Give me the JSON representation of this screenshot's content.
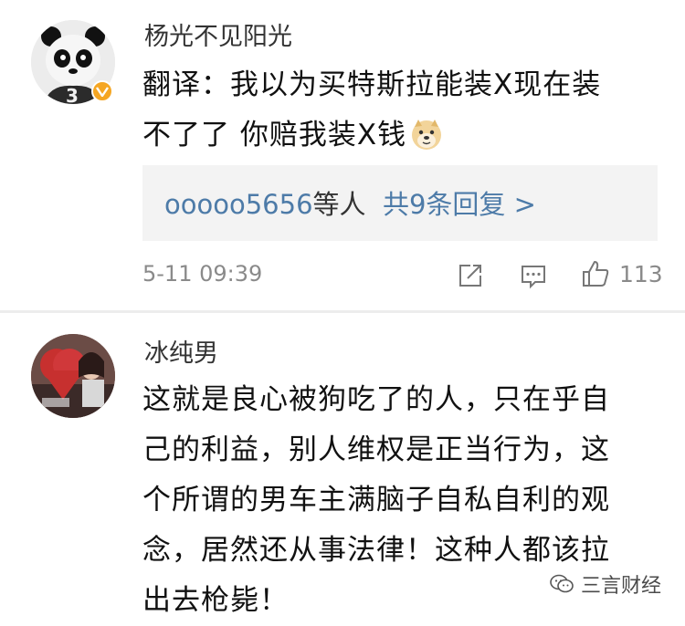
{
  "comments": [
    {
      "username": "杨光不见阳光",
      "content_lines": [
        "翻译：我以为买特斯拉能装X现在装",
        "不了了 你赔我装X钱"
      ],
      "emoji": "doge-emoji",
      "reply": {
        "user": "ooooo5656",
        "mid": "等人",
        "count": "共9条回复 >"
      },
      "timestamp": "5-11 09:39",
      "like_count": "113",
      "verified": true
    },
    {
      "username": "冰纯男",
      "content_lines": [
        "这就是良心被狗吃了的人，只在乎自",
        "己的利益，别人维权是正当行为，这",
        "个所谓的男车主满脑子自私自利的观",
        "念，居然还从事法律！这种人都该拉",
        "出去枪毙！"
      ]
    }
  ],
  "watermark": {
    "text": "三言财经"
  },
  "colors": {
    "link": "#4d7ba8",
    "reply_bg": "#f3f3f3",
    "meta": "#8a8a8a",
    "verified": "#f5a623"
  },
  "icons": [
    "share-icon",
    "comment-icon",
    "like-icon",
    "wechat-icon"
  ]
}
